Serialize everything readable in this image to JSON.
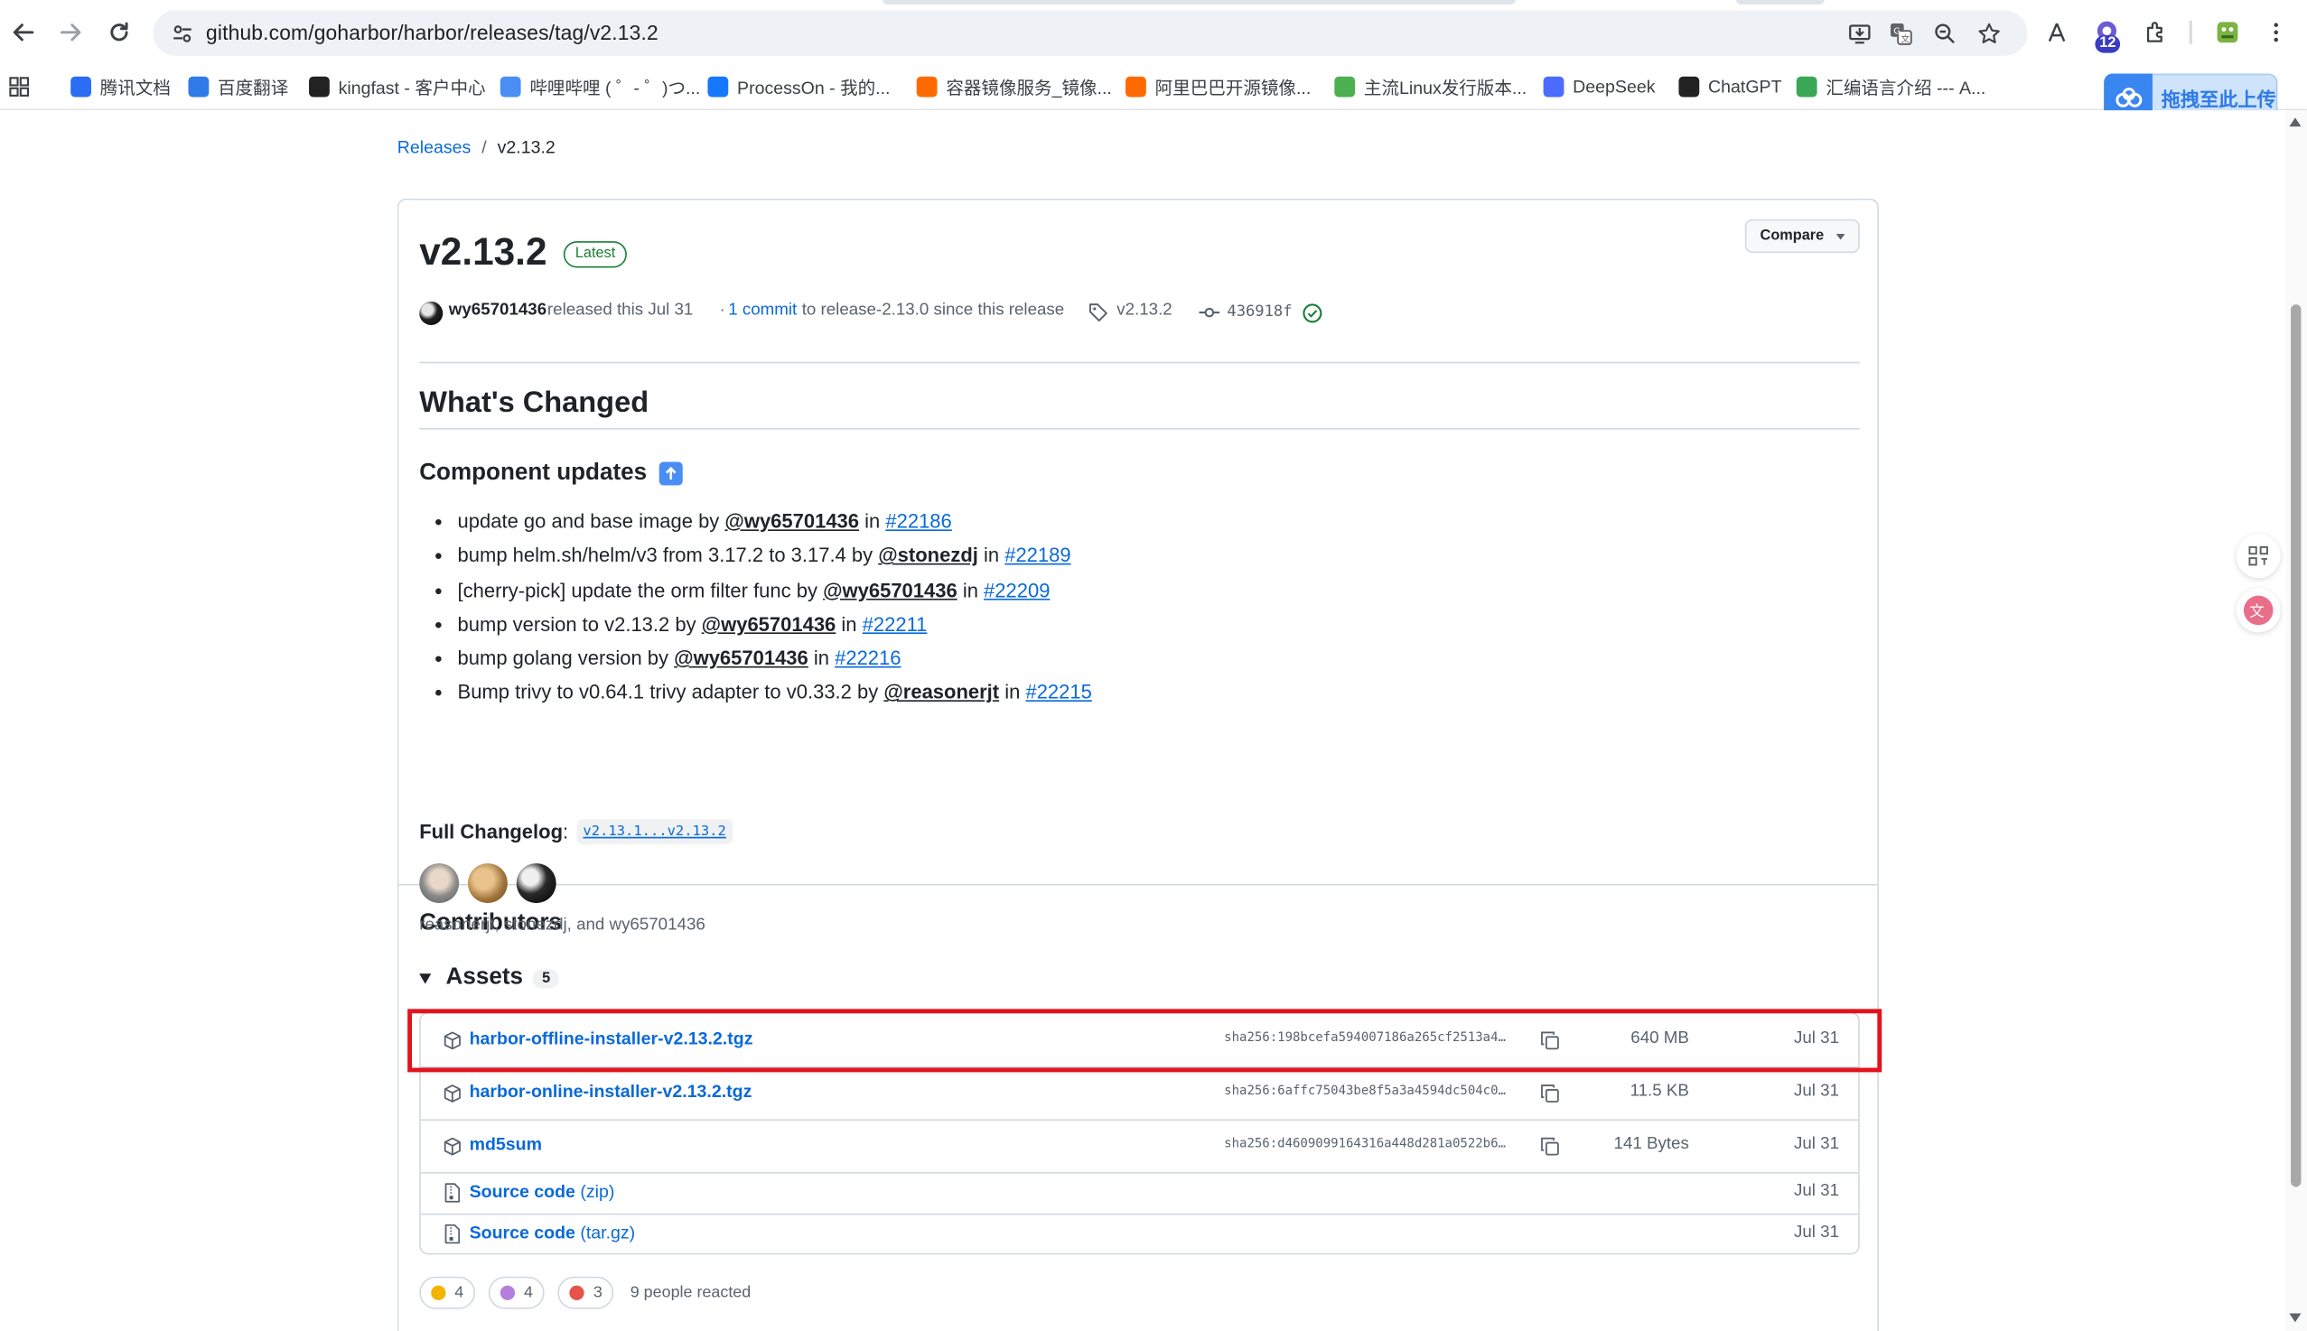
{
  "browser": {
    "url": "github.com/goharbor/harbor/releases/tag/v2.13.2",
    "extension_badge": "12",
    "bookmarks": [
      {
        "label": "腾讯文档",
        "color": "#2b6ef5"
      },
      {
        "label": "百度翻译",
        "color": "#2f7be8"
      },
      {
        "label": "kingfast - 客户中心",
        "color": "#222222"
      },
      {
        "label": "哔哩哔哩 ( ゜- ゜)つ...",
        "color": "#4a8ef5"
      },
      {
        "label": "ProcessOn - 我的...",
        "color": "#1677ff"
      },
      {
        "label": "容器镜像服务_镜像...",
        "color": "#ff6a00"
      },
      {
        "label": "阿里巴巴开源镜像...",
        "color": "#ff6a00"
      },
      {
        "label": "主流Linux发行版本...",
        "color": "#4caf50"
      },
      {
        "label": "DeepSeek",
        "color": "#4d6bfe"
      },
      {
        "label": "ChatGPT",
        "color": "#222222"
      },
      {
        "label": "汇编语言介绍 --- A...",
        "color": "#3aa757"
      }
    ],
    "upload_button": "拖拽至此上传"
  },
  "breadcrumb": {
    "root": "Releases",
    "sep": "/",
    "current": "v2.13.2"
  },
  "release": {
    "title": "v2.13.2",
    "badge": "Latest",
    "compare_label": "Compare",
    "author": "wy65701436",
    "released_text": "released this Jul 31",
    "commits_prefix": "·",
    "commits_link": "1 commit",
    "commits_suffix": "to release-2.13.0 since this release",
    "tag": "v2.13.2",
    "commit_sha": "436918f"
  },
  "notes": {
    "heading": "What's Changed",
    "subheading": "Component updates",
    "items": [
      {
        "text": "update go and base image by ",
        "user": "@wy65701436",
        "in": " in ",
        "pr": "#22186"
      },
      {
        "text": "bump helm.sh/helm/v3 from 3.17.2 to 3.17.4 by ",
        "user": "@stonezdj",
        "in": " in ",
        "pr": "#22189"
      },
      {
        "text": "[cherry-pick] update the orm filter func by ",
        "user": "@wy65701436",
        "in": " in ",
        "pr": "#22209"
      },
      {
        "text": "bump version to v2.13.2 by ",
        "user": "@wy65701436",
        "in": " in ",
        "pr": "#22211"
      },
      {
        "text": "bump golang version by ",
        "user": "@wy65701436",
        "in": " in ",
        "pr": "#22216"
      },
      {
        "text": "Bump trivy to v0.64.1 trivy adapter to v0.33.2 by ",
        "user": "@reasonerjt",
        "in": " in ",
        "pr": "#22215"
      }
    ],
    "changelog_label": "Full Changelog",
    "changelog_colon": ":",
    "changelog_link": "v2.13.1...v2.13.2"
  },
  "contributors": {
    "heading": "Contributors",
    "names": "reasonerjt, stonezdj, and wy65701436"
  },
  "assets": {
    "heading": "Assets",
    "count": "5",
    "rows": [
      {
        "name": "harbor-offline-installer-v2.13.2.tgz",
        "suffix": "",
        "sha": "sha256:198bcefa594007186a265cf2513a4…",
        "size": "640 MB",
        "date": "Jul 31",
        "icon": "package-icon"
      },
      {
        "name": "harbor-online-installer-v2.13.2.tgz",
        "suffix": "",
        "sha": "sha256:6affc75043be8f5a3a4594dc504c0…",
        "size": "11.5 KB",
        "date": "Jul 31",
        "icon": "package-icon"
      },
      {
        "name": "md5sum",
        "suffix": "",
        "sha": "sha256:d4609099164316a448d281a0522b6…",
        "size": "141 Bytes",
        "date": "Jul 31",
        "icon": "package-icon"
      },
      {
        "name": "Source code",
        "suffix": " (zip)",
        "sha": "",
        "size": "",
        "date": "Jul 31",
        "icon": "file-zip-icon"
      },
      {
        "name": "Source code",
        "suffix": " (tar.gz)",
        "sha": "",
        "size": "",
        "date": "Jul 31",
        "icon": "file-zip-icon"
      }
    ]
  },
  "reactions": {
    "items": [
      {
        "emoji": "thumbs-up",
        "count": "4",
        "color": "#f4b400"
      },
      {
        "emoji": "party-popper",
        "count": "4",
        "color": "#b57edc"
      },
      {
        "emoji": "heart",
        "count": "3",
        "color": "#e5534b"
      }
    ],
    "summary": "9 people reacted"
  },
  "colors": {
    "link": "#0969da",
    "highlight": "#e3131d",
    "latest": "#1a7f37"
  }
}
